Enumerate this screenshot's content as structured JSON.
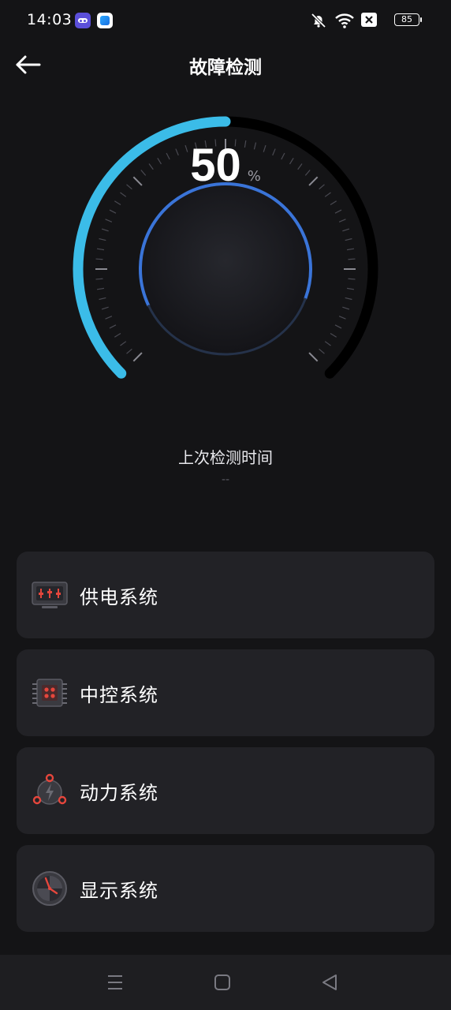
{
  "status_bar": {
    "time": "14:03",
    "battery": "85",
    "icons": [
      "mute-icon",
      "wifi-icon",
      "close-box-icon",
      "battery-icon"
    ]
  },
  "header": {
    "title": "故障检测",
    "back_icon": "arrow-left-icon"
  },
  "gauge": {
    "value": "50",
    "unit": "%",
    "progress_percent": 50,
    "colors": {
      "active": "#3bbce8",
      "inactive": "#000000",
      "inner_ring": "#3a74d8"
    }
  },
  "last_check": {
    "label": "上次检测时间",
    "value": "--"
  },
  "systems": [
    {
      "label": "供电系统",
      "icon": "power-supply-icon"
    },
    {
      "label": "中控系统",
      "icon": "chip-icon"
    },
    {
      "label": "动力系统",
      "icon": "motor-icon"
    },
    {
      "label": "显示系统",
      "icon": "dashboard-icon"
    }
  ],
  "nav_bar": {
    "icons": [
      "menu-icon",
      "home-icon",
      "back-triangle-icon"
    ]
  },
  "colors": {
    "background": "#141416",
    "card": "#222226",
    "accent_red": "#e5463c"
  }
}
